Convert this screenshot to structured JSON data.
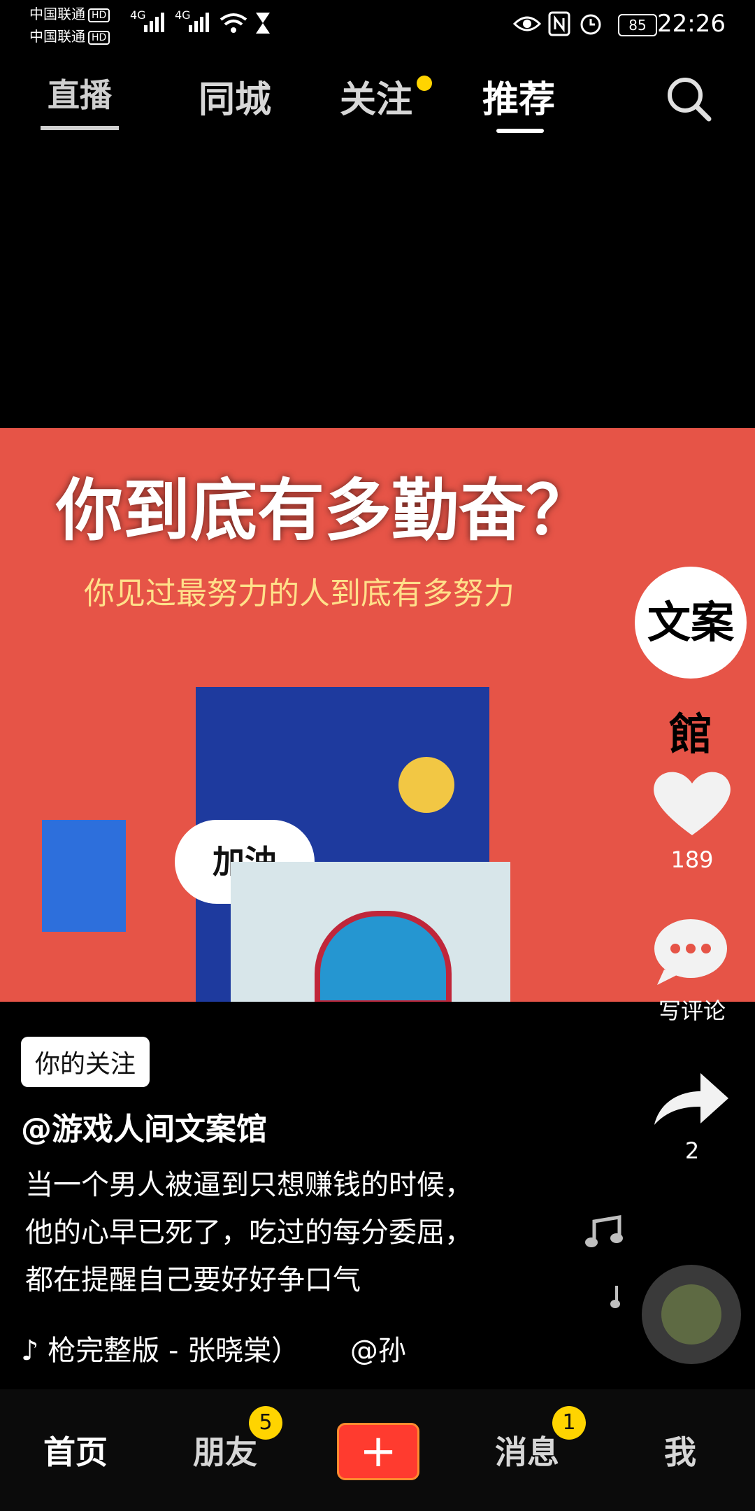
{
  "status_bar": {
    "carrier1": "中国联通",
    "carrier2": "中国联通",
    "hd": "HD",
    "network": "4G",
    "battery": "85",
    "time": "22:26"
  },
  "top_nav": {
    "live_icon_label": "直播",
    "tabs": [
      "同城",
      "关注",
      "推荐"
    ],
    "active_tab": "推荐"
  },
  "video": {
    "title": "你到底有多勤奋？",
    "subtitle": "你见过最努力的人到底有多努力",
    "bubble_text": "加油"
  },
  "right_rail": {
    "channel_avatar_text": "文案館",
    "likes": "189",
    "comment_label": "写评论",
    "shares": "2"
  },
  "post": {
    "follow_badge": "你的关注",
    "author": "@游戏人间文案馆",
    "description_lines": [
      "当一个男人被逼到只想赚钱的时候，",
      "他的心早已死了，吃过的每分委屈，",
      "都在提醒自己要好好争口气"
    ],
    "music_text": "枪完整版 - 张晓棠）",
    "music_tail": "@孙"
  },
  "bottom_nav": {
    "home": "首页",
    "friends": "朋友",
    "friends_badge": "5",
    "plus": "+",
    "messages": "消息",
    "messages_badge": "1",
    "me": "我"
  }
}
